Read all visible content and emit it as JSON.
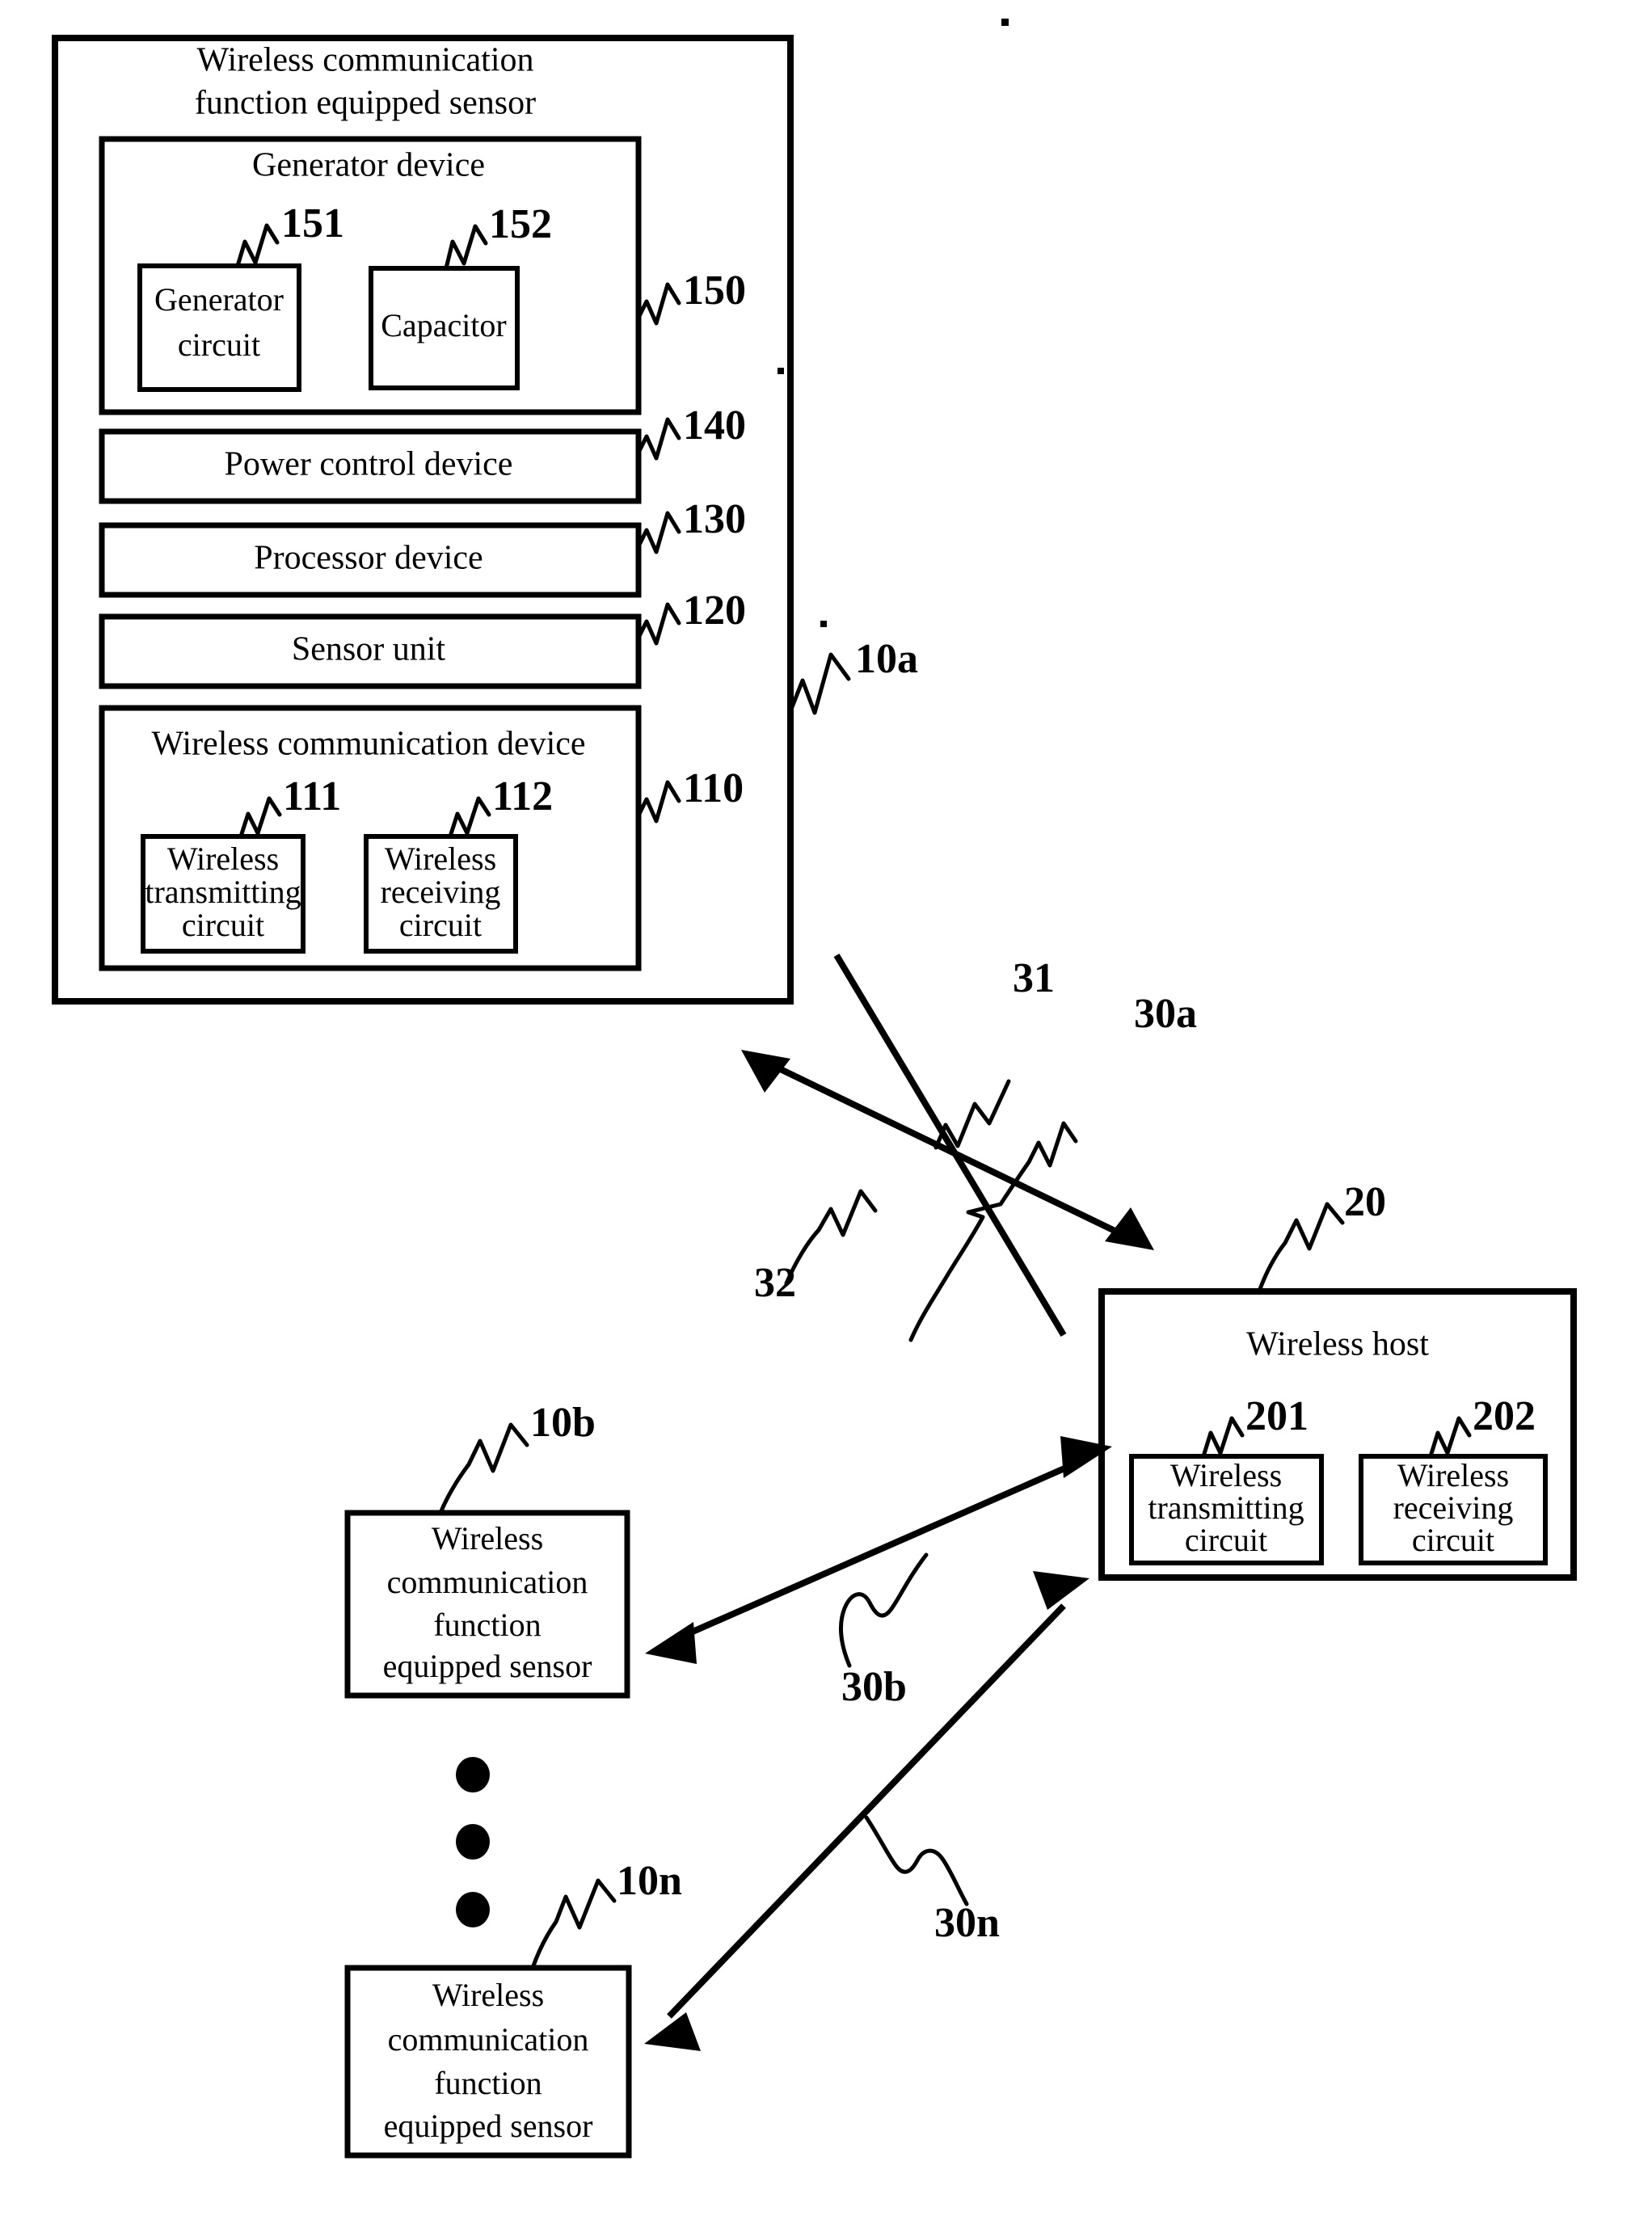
{
  "figure": {
    "type": "patent-block-diagram",
    "background_color": "#ffffff",
    "ink_color": "#000000"
  },
  "sensor_main": {
    "title_line1": "Wireless communication",
    "title_line2": "function equipped sensor",
    "ref": "10a",
    "blocks": {
      "generator_device": {
        "label": "Generator device",
        "ref": "150",
        "children": [
          {
            "label_line1": "Generator",
            "label_line2": "circuit",
            "ref": "151"
          },
          {
            "label_line1": "Capacitor",
            "label_line2": "",
            "ref": "152"
          }
        ]
      },
      "power_control_device": {
        "label": "Power control device",
        "ref": "140"
      },
      "processor_device": {
        "label": "Processor device",
        "ref": "130"
      },
      "sensor_unit": {
        "label": "Sensor unit",
        "ref": "120"
      },
      "wireless_communication_device": {
        "label": "Wireless communication device",
        "ref": "110",
        "children": [
          {
            "label_line1": "Wireless",
            "label_line2": "transmitting",
            "label_line3": "circuit",
            "ref": "111"
          },
          {
            "label_line1": "Wireless",
            "label_line2": "receiving",
            "label_line3": "circuit",
            "ref": "112"
          }
        ]
      }
    }
  },
  "links": {
    "link_30a": {
      "ref": "30a",
      "style": "double-headed-arrow"
    },
    "line_31": {
      "ref": "31",
      "style": "plain-line"
    },
    "label_32": {
      "ref": "32"
    },
    "link_30b": {
      "ref": "30b",
      "style": "double-headed-arrow"
    },
    "link_30n": {
      "ref": "30n",
      "style": "double-headed-arrow"
    }
  },
  "host": {
    "label": "Wireless host",
    "ref": "20",
    "children": [
      {
        "label_line1": "Wireless",
        "label_line2": "transmitting",
        "label_line3": "circuit",
        "ref": "201"
      },
      {
        "label_line1": "Wireless",
        "label_line2": "receiving",
        "label_line3": "circuit",
        "ref": "202"
      }
    ]
  },
  "sensor_b": {
    "ref": "10b",
    "label_line1": "Wireless",
    "label_line2": "communication",
    "label_line3": "function",
    "label_line4": "equipped sensor"
  },
  "sensor_n": {
    "ref": "10n",
    "label_line1": "Wireless",
    "label_line2": "communication",
    "label_line3": "function",
    "label_line4": "equipped sensor"
  },
  "ellipsis": {
    "dot_count": 3
  }
}
